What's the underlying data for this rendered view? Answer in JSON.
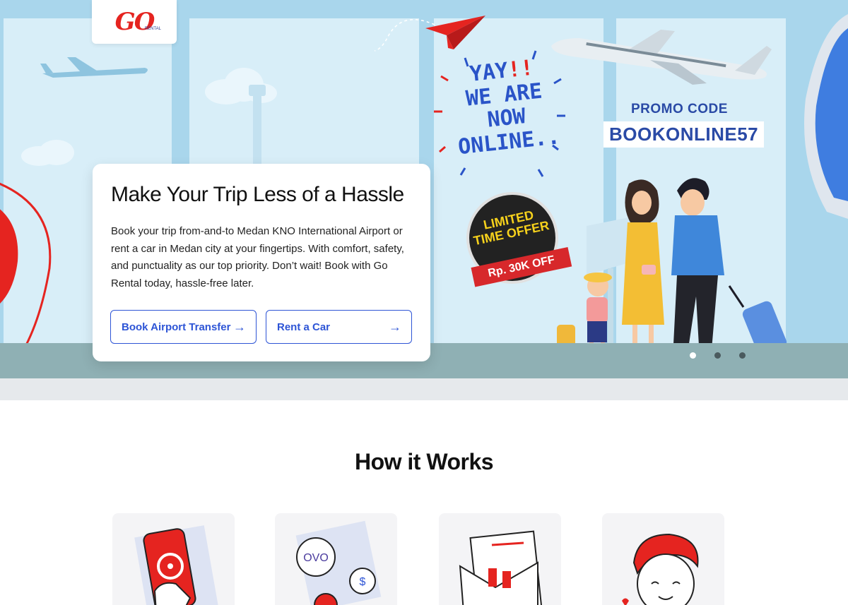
{
  "brand": {
    "logo_text": "GO",
    "logo_subtext": "RENTAL"
  },
  "hero": {
    "headline": "Make Your Trip Less of a Hassle",
    "description": "Book your trip from-and-to Medan KNO International Airport or rent a car in Medan city at your fingertips. With comfort, safety, and punctuality as our top priority. Don’t wait! Book with Go Rental today, hassle-free later.",
    "buttons": [
      {
        "label": "Book Airport Transfer",
        "icon": "arrow-right-icon"
      },
      {
        "label": "Rent a Car",
        "icon": "arrow-right-icon"
      }
    ],
    "banner": {
      "yay_line1": "YAY",
      "yay_excl": "!!",
      "yay_line2": "WE ARE",
      "yay_line3": "NOW",
      "yay_line4": "ONLINE..",
      "promo_label": "PROMO CODE",
      "promo_code": "BOOKONLINE57",
      "offer_line1": "LIMITED",
      "offer_line2": "TIME OFFER",
      "offer_ribbon": "Rp. 30K OFF"
    },
    "carousel": {
      "slides": 3,
      "active_index": 0
    }
  },
  "how_it_works": {
    "title": "How it Works",
    "steps": [
      {
        "icon": "phone-steering-wheel-icon"
      },
      {
        "icon": "ovo-coins-icon",
        "coin_label": "OVO"
      },
      {
        "icon": "envelope-keys-icon"
      },
      {
        "icon": "happy-customer-icon"
      }
    ]
  },
  "colors": {
    "primary_blue": "#2e55d6",
    "brand_red": "#e52420",
    "sky": "#a9d6ec"
  }
}
